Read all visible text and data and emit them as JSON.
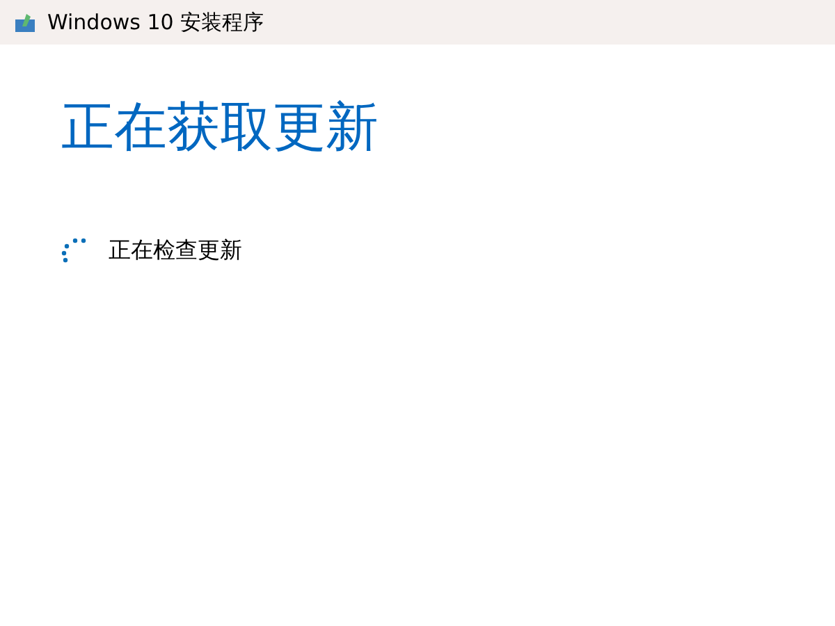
{
  "window": {
    "title": "Windows 10 安装程序"
  },
  "heading": "正在获取更新",
  "status": {
    "text": "正在检查更新"
  }
}
